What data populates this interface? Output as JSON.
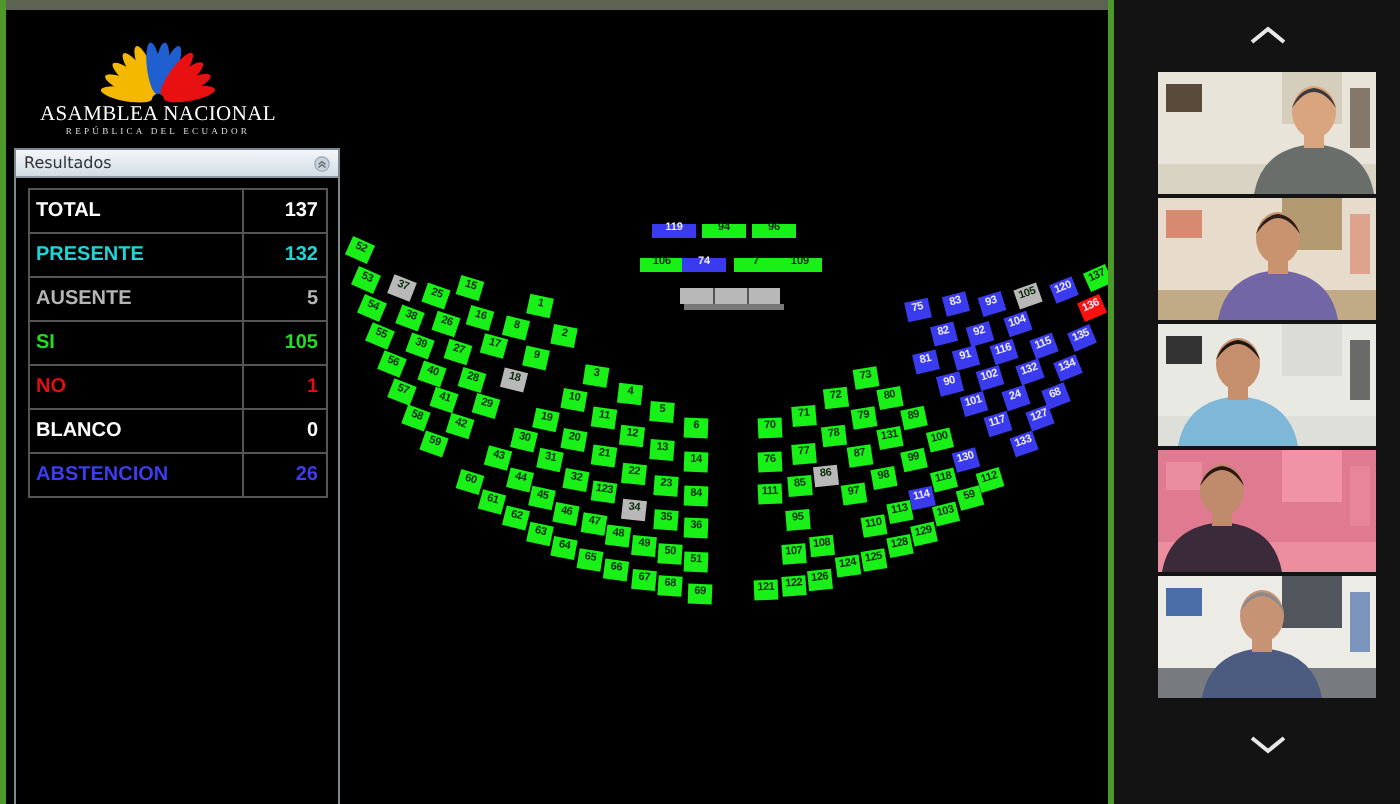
{
  "logo": {
    "title": "ASAMBLEA NACIONAL",
    "subtitle": "REPÚBLICA DEL ECUADOR"
  },
  "results_panel": {
    "title": "Resultados",
    "rows": [
      {
        "label": "TOTAL",
        "value": "137",
        "kind": "total"
      },
      {
        "label": "PRESENTE",
        "value": "132",
        "kind": "present"
      },
      {
        "label": "AUSENTE",
        "value": "5",
        "kind": "absent"
      },
      {
        "label": "SI",
        "value": "105",
        "kind": "yes"
      },
      {
        "label": "NO",
        "value": "1",
        "kind": "no"
      },
      {
        "label": "BLANCO",
        "value": "0",
        "kind": "blank"
      },
      {
        "label": "ABSTENCION",
        "value": "26",
        "kind": "abstention"
      }
    ]
  },
  "front_seats": [
    {
      "number": "119",
      "color": "#3a3aee"
    },
    {
      "number": "94",
      "color": "#18f018"
    },
    {
      "number": "96",
      "color": "#18f018"
    },
    {
      "number": "106",
      "color": "#18f018"
    },
    {
      "number": "74",
      "color": "#3a3aee"
    },
    {
      "number": "7",
      "color": "#18f018"
    },
    {
      "number": "109",
      "color": "#18f018"
    }
  ],
  "seats": [
    {
      "number": "52",
      "color": "#18f018"
    },
    {
      "number": "53",
      "color": "#18f018"
    },
    {
      "number": "54",
      "color": "#18f018"
    },
    {
      "number": "55",
      "color": "#18f018"
    },
    {
      "number": "56",
      "color": "#18f018"
    },
    {
      "number": "57",
      "color": "#18f018"
    },
    {
      "number": "58",
      "color": "#18f018"
    },
    {
      "number": "59",
      "color": "#18f018"
    },
    {
      "number": "37",
      "color": "#b8b8b8"
    },
    {
      "number": "38",
      "color": "#18f018"
    },
    {
      "number": "39",
      "color": "#18f018"
    },
    {
      "number": "40",
      "color": "#18f018"
    },
    {
      "number": "41",
      "color": "#18f018"
    },
    {
      "number": "42",
      "color": "#18f018"
    },
    {
      "number": "25",
      "color": "#18f018"
    },
    {
      "number": "26",
      "color": "#18f018"
    },
    {
      "number": "27",
      "color": "#18f018"
    },
    {
      "number": "28",
      "color": "#18f018"
    },
    {
      "number": "29",
      "color": "#18f018"
    },
    {
      "number": "15",
      "color": "#18f018"
    },
    {
      "number": "16",
      "color": "#18f018"
    },
    {
      "number": "17",
      "color": "#18f018"
    },
    {
      "number": "18",
      "color": "#b8b8b8"
    },
    {
      "number": "8",
      "color": "#18f018"
    },
    {
      "number": "9",
      "color": "#18f018"
    },
    {
      "number": "1",
      "color": "#18f018"
    },
    {
      "number": "2",
      "color": "#18f018"
    },
    {
      "number": "3",
      "color": "#18f018"
    },
    {
      "number": "4",
      "color": "#18f018"
    },
    {
      "number": "5",
      "color": "#18f018"
    },
    {
      "number": "6",
      "color": "#18f018"
    },
    {
      "number": "10",
      "color": "#18f018"
    },
    {
      "number": "11",
      "color": "#18f018"
    },
    {
      "number": "12",
      "color": "#18f018"
    },
    {
      "number": "13",
      "color": "#18f018"
    },
    {
      "number": "14",
      "color": "#18f018"
    },
    {
      "number": "19",
      "color": "#18f018"
    },
    {
      "number": "20",
      "color": "#18f018"
    },
    {
      "number": "21",
      "color": "#18f018"
    },
    {
      "number": "22",
      "color": "#18f018"
    },
    {
      "number": "23",
      "color": "#18f018"
    },
    {
      "number": "84",
      "color": "#18f018"
    },
    {
      "number": "30",
      "color": "#18f018"
    },
    {
      "number": "31",
      "color": "#18f018"
    },
    {
      "number": "32",
      "color": "#18f018"
    },
    {
      "number": "123",
      "color": "#18f018"
    },
    {
      "number": "34",
      "color": "#b8b8b8"
    },
    {
      "number": "35",
      "color": "#18f018"
    },
    {
      "number": "36",
      "color": "#18f018"
    },
    {
      "number": "43",
      "color": "#18f018"
    },
    {
      "number": "44",
      "color": "#18f018"
    },
    {
      "number": "45",
      "color": "#18f018"
    },
    {
      "number": "46",
      "color": "#18f018"
    },
    {
      "number": "47",
      "color": "#18f018"
    },
    {
      "number": "48",
      "color": "#18f018"
    },
    {
      "number": "49",
      "color": "#18f018"
    },
    {
      "number": "50",
      "color": "#18f018"
    },
    {
      "number": "51",
      "color": "#18f018"
    },
    {
      "number": "60",
      "color": "#18f018"
    },
    {
      "number": "61",
      "color": "#18f018"
    },
    {
      "number": "62",
      "color": "#18f018"
    },
    {
      "number": "63",
      "color": "#18f018"
    },
    {
      "number": "64",
      "color": "#18f018"
    },
    {
      "number": "65",
      "color": "#18f018"
    },
    {
      "number": "66",
      "color": "#18f018"
    },
    {
      "number": "67",
      "color": "#18f018"
    },
    {
      "number": "68",
      "color": "#18f018"
    },
    {
      "number": "69",
      "color": "#18f018"
    },
    {
      "number": "75",
      "color": "#3a3aee"
    },
    {
      "number": "83",
      "color": "#3a3aee"
    },
    {
      "number": "93",
      "color": "#3a3aee"
    },
    {
      "number": "105",
      "color": "#b8b8b8"
    },
    {
      "number": "120",
      "color": "#3a3aee"
    },
    {
      "number": "137",
      "color": "#18f018"
    },
    {
      "number": "136",
      "color": "#ff1010"
    },
    {
      "number": "82",
      "color": "#3a3aee"
    },
    {
      "number": "92",
      "color": "#3a3aee"
    },
    {
      "number": "104",
      "color": "#3a3aee"
    },
    {
      "number": "135",
      "color": "#3a3aee"
    },
    {
      "number": "81",
      "color": "#3a3aee"
    },
    {
      "number": "91",
      "color": "#3a3aee"
    },
    {
      "number": "116",
      "color": "#3a3aee"
    },
    {
      "number": "115",
      "color": "#3a3aee"
    },
    {
      "number": "134",
      "color": "#3a3aee"
    },
    {
      "number": "90",
      "color": "#3a3aee"
    },
    {
      "number": "102",
      "color": "#3a3aee"
    },
    {
      "number": "132",
      "color": "#3a3aee"
    },
    {
      "number": "68",
      "color": "#3a3aee"
    },
    {
      "number": "101",
      "color": "#3a3aee"
    },
    {
      "number": "24",
      "color": "#3a3aee"
    },
    {
      "number": "127",
      "color": "#3a3aee"
    },
    {
      "number": "117",
      "color": "#3a3aee"
    },
    {
      "number": "133",
      "color": "#3a3aee"
    },
    {
      "number": "73",
      "color": "#18f018"
    },
    {
      "number": "72",
      "color": "#18f018"
    },
    {
      "number": "80",
      "color": "#18f018"
    },
    {
      "number": "71",
      "color": "#18f018"
    },
    {
      "number": "79",
      "color": "#18f018"
    },
    {
      "number": "89",
      "color": "#18f018"
    },
    {
      "number": "70",
      "color": "#18f018"
    },
    {
      "number": "78",
      "color": "#18f018"
    },
    {
      "number": "131",
      "color": "#18f018"
    },
    {
      "number": "100",
      "color": "#18f018"
    },
    {
      "number": "76",
      "color": "#18f018"
    },
    {
      "number": "77",
      "color": "#18f018"
    },
    {
      "number": "86",
      "color": "#b8b8b8"
    },
    {
      "number": "87",
      "color": "#18f018"
    },
    {
      "number": "99",
      "color": "#18f018"
    },
    {
      "number": "130",
      "color": "#3a3aee"
    },
    {
      "number": "111",
      "color": "#18f018"
    },
    {
      "number": "85",
      "color": "#18f018"
    },
    {
      "number": "97",
      "color": "#18f018"
    },
    {
      "number": "98",
      "color": "#18f018"
    },
    {
      "number": "118",
      "color": "#18f018"
    },
    {
      "number": "112",
      "color": "#18f018"
    },
    {
      "number": "114",
      "color": "#3a3aee"
    },
    {
      "number": "95",
      "color": "#18f018"
    },
    {
      "number": "110",
      "color": "#18f018"
    },
    {
      "number": "113",
      "color": "#18f018"
    },
    {
      "number": "103",
      "color": "#18f018"
    },
    {
      "number": "59",
      "color": "#18f018"
    },
    {
      "number": "107",
      "color": "#18f018"
    },
    {
      "number": "108",
      "color": "#18f018"
    },
    {
      "number": "129",
      "color": "#18f018"
    },
    {
      "number": "128",
      "color": "#18f018"
    },
    {
      "number": "125",
      "color": "#18f018"
    },
    {
      "number": "124",
      "color": "#18f018"
    },
    {
      "number": "126",
      "color": "#18f018"
    },
    {
      "number": "122",
      "color": "#18f018"
    },
    {
      "number": "121",
      "color": "#18f018"
    }
  ]
}
